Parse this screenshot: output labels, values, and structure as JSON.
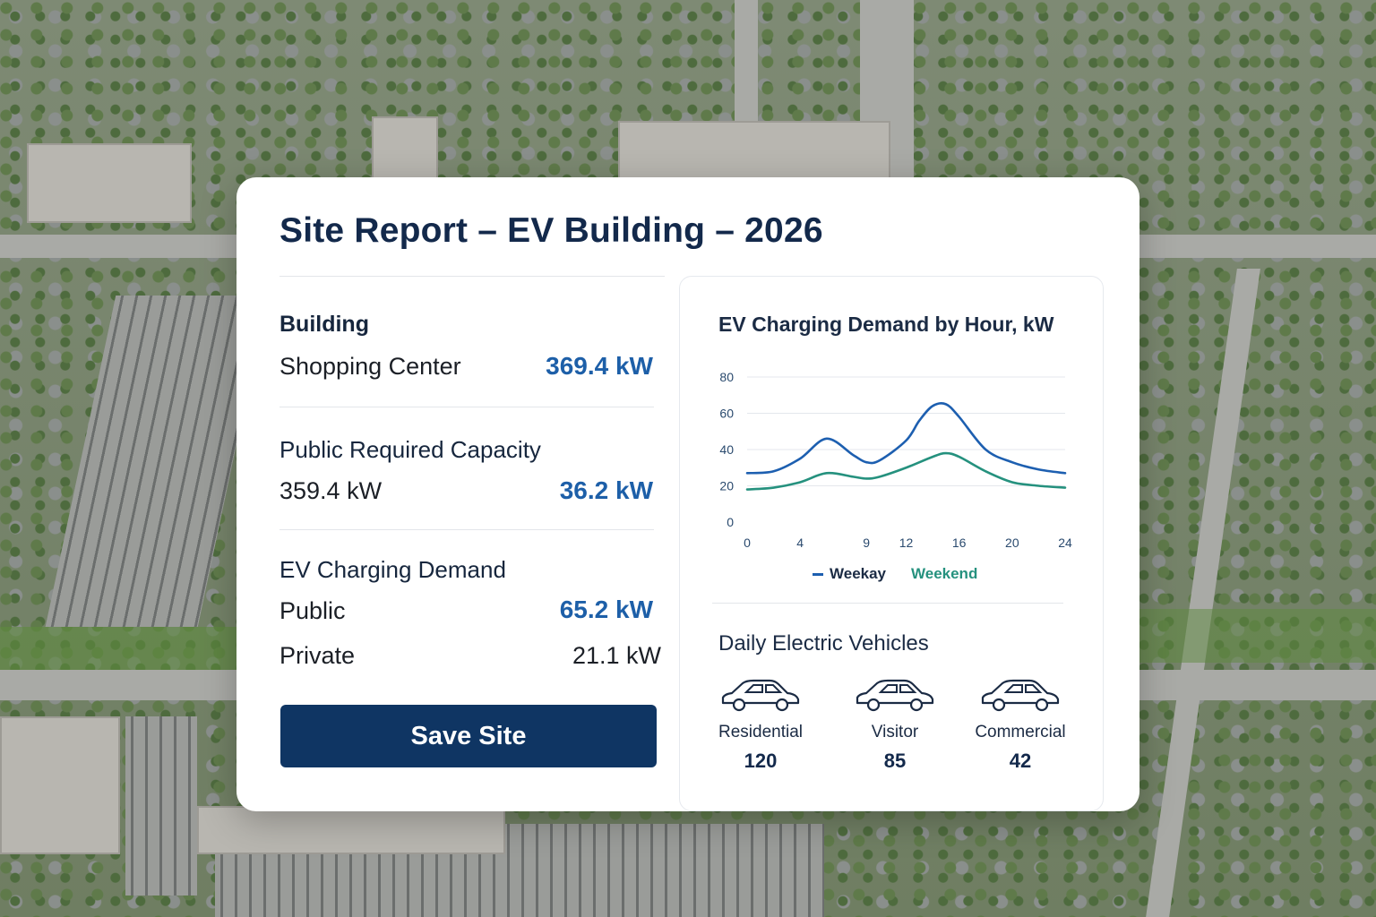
{
  "header": {
    "title": "Site Report – EV Building – 2026"
  },
  "building": {
    "section_label": "Building",
    "type": "Shopping Center",
    "value": "369.4 kW"
  },
  "capacity": {
    "section_label": "Public Required Capacity",
    "left_value": "359.4 kW",
    "right_value": "36.2 kW"
  },
  "demand": {
    "section_label": "EV Charging Demand",
    "public_label": "Public",
    "public_value": "65.2 kW",
    "private_label": "Private",
    "private_value": "21.1 kW"
  },
  "actions": {
    "save_label": "Save Site"
  },
  "chart_data": {
    "type": "line",
    "title": "EV Charging Demand by Hour, kW",
    "xlabel": "",
    "ylabel": "",
    "x_ticks": [
      0,
      4,
      9,
      12,
      16,
      20,
      24
    ],
    "y_ticks": [
      0,
      20,
      40,
      60,
      80
    ],
    "xlim": [
      0,
      24
    ],
    "ylim": [
      0,
      80
    ],
    "grid": true,
    "legend_placement": "bottom",
    "series": [
      {
        "name": "Weekay",
        "color": "#1d5fb0",
        "x": [
          0,
          2,
          4,
          6,
          8,
          9,
          10,
          12,
          13,
          14,
          15,
          16,
          18,
          20,
          22,
          24
        ],
        "y": [
          27,
          28,
          35,
          46,
          37,
          33,
          34,
          45,
          56,
          64,
          65,
          58,
          40,
          33,
          29,
          27
        ]
      },
      {
        "name": "Weekend",
        "color": "#25917e",
        "x": [
          0,
          2,
          4,
          6,
          8,
          9,
          10,
          12,
          14,
          15,
          16,
          18,
          20,
          22,
          24
        ],
        "y": [
          18,
          19,
          22,
          27,
          25,
          24,
          25,
          30,
          36,
          38,
          36,
          28,
          22,
          20,
          19
        ]
      }
    ]
  },
  "daily_ev": {
    "title": "Daily Electric Vehicles",
    "items": [
      {
        "name": "Residential",
        "count": "120"
      },
      {
        "name": "Visitor",
        "count": "85"
      },
      {
        "name": "Commercial",
        "count": "42"
      }
    ]
  }
}
